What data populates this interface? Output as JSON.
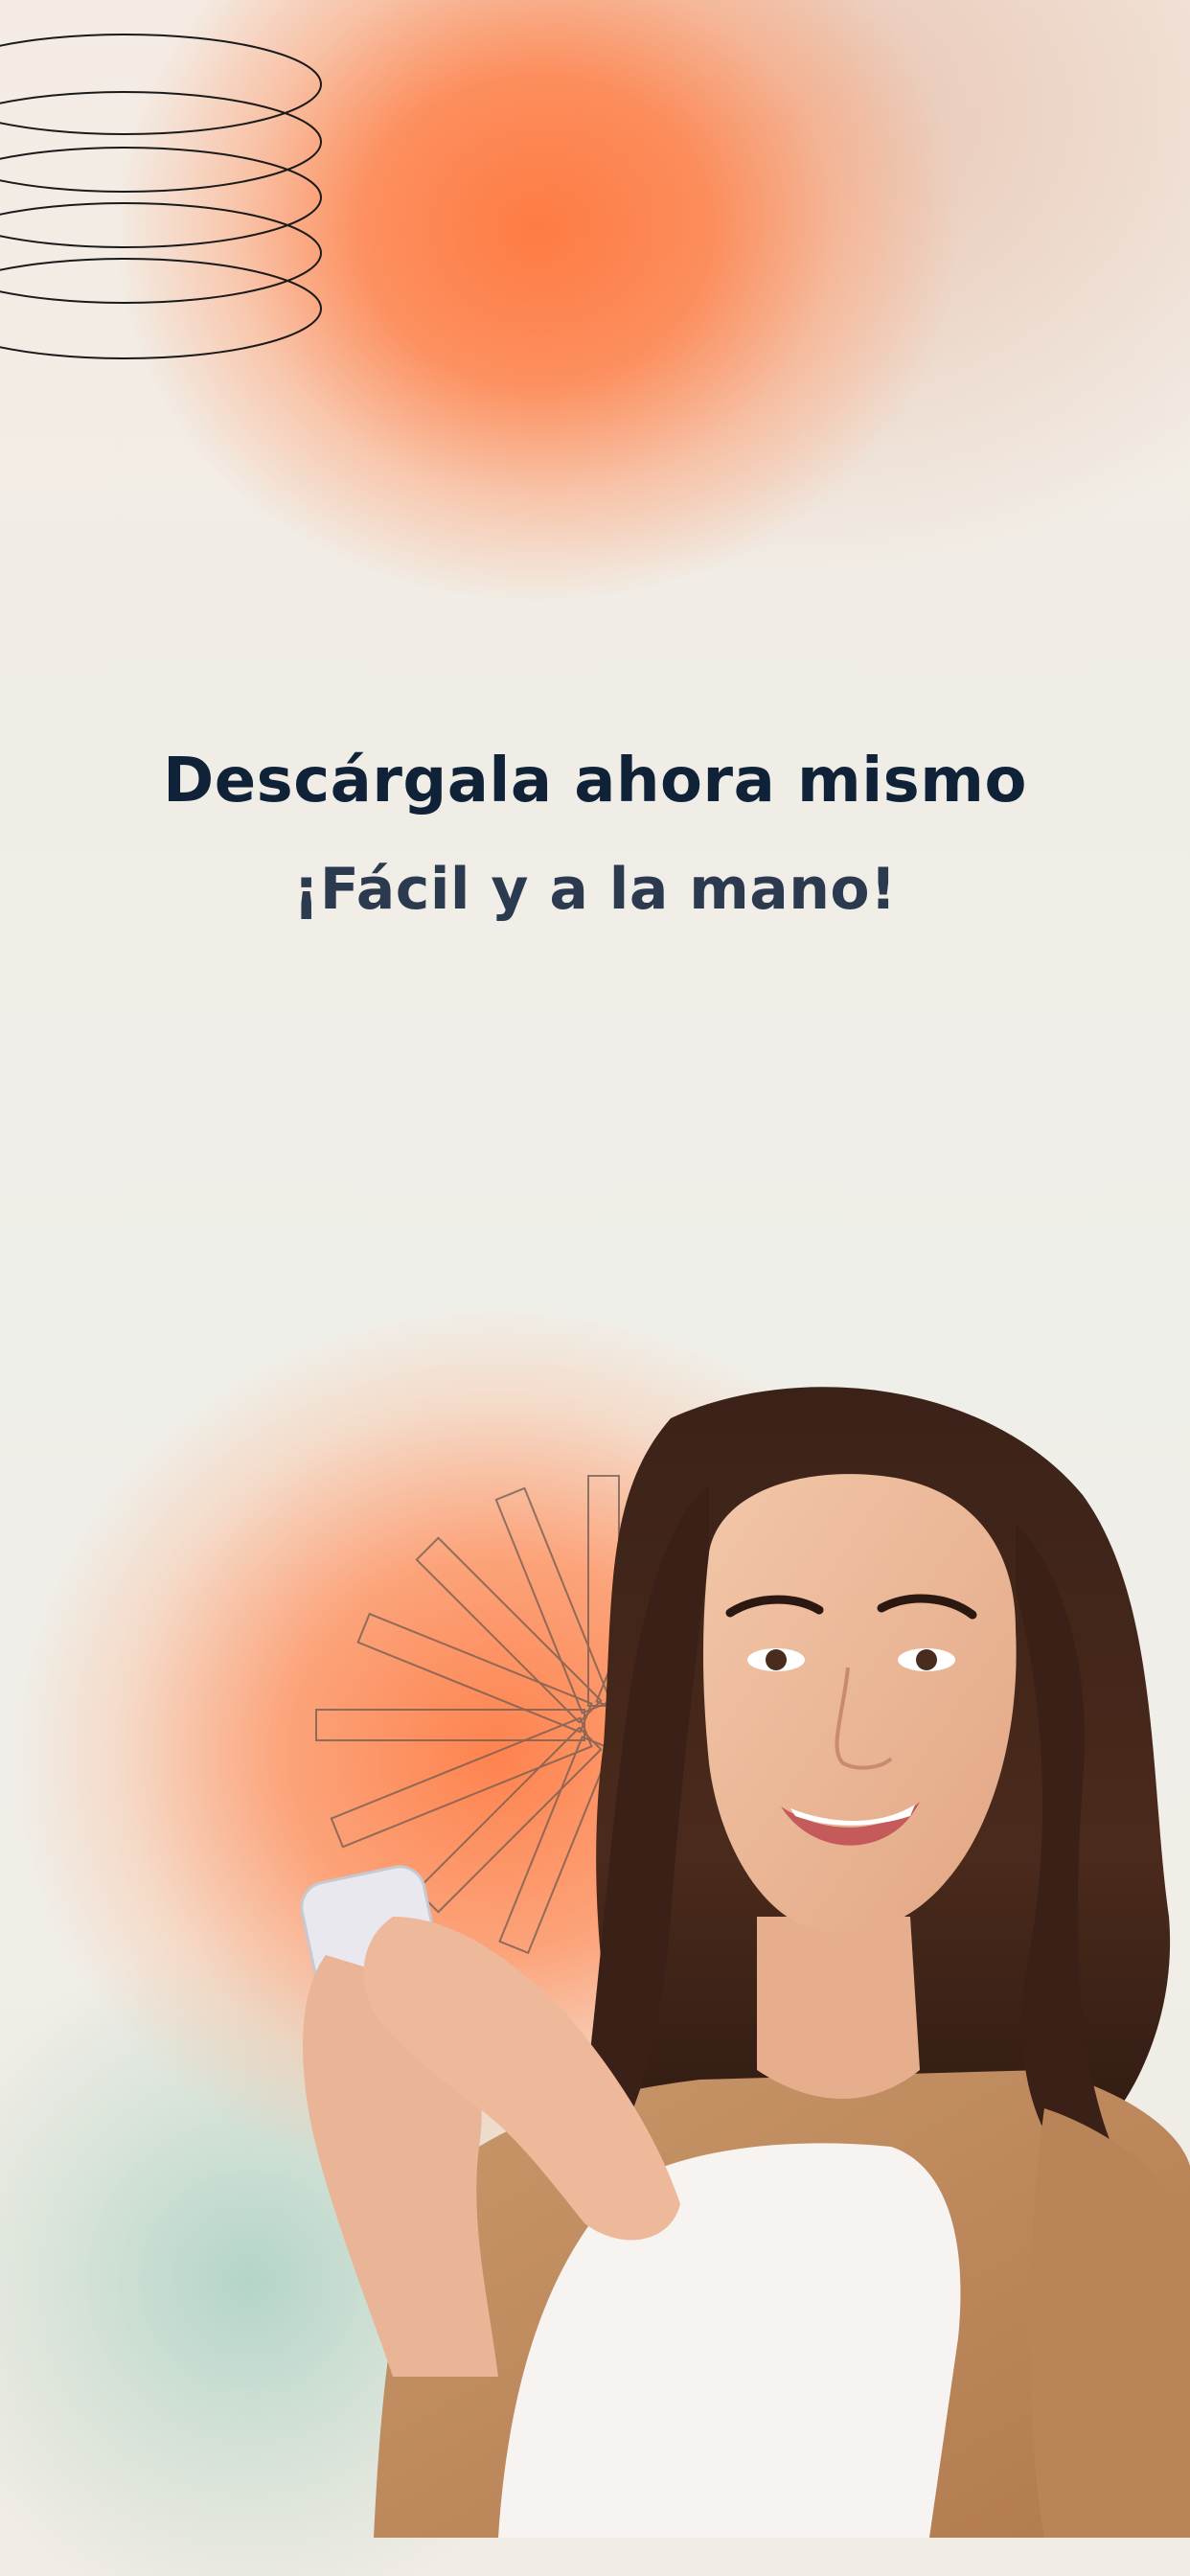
{
  "hero": {
    "headline": "Descárgala ahora mismo",
    "subline": "¡Fácil y a la mano!"
  },
  "colors": {
    "headline": "#0f2238",
    "subline": "#2c3a4f",
    "accent_orange": "#ff7a45",
    "mint": "#a8d2c4"
  },
  "decorations": {
    "rings": "concentric-ellipse-lines",
    "burst": "radial-outline-rays"
  },
  "image": {
    "subject": "smiling-woman-holding-phone"
  }
}
